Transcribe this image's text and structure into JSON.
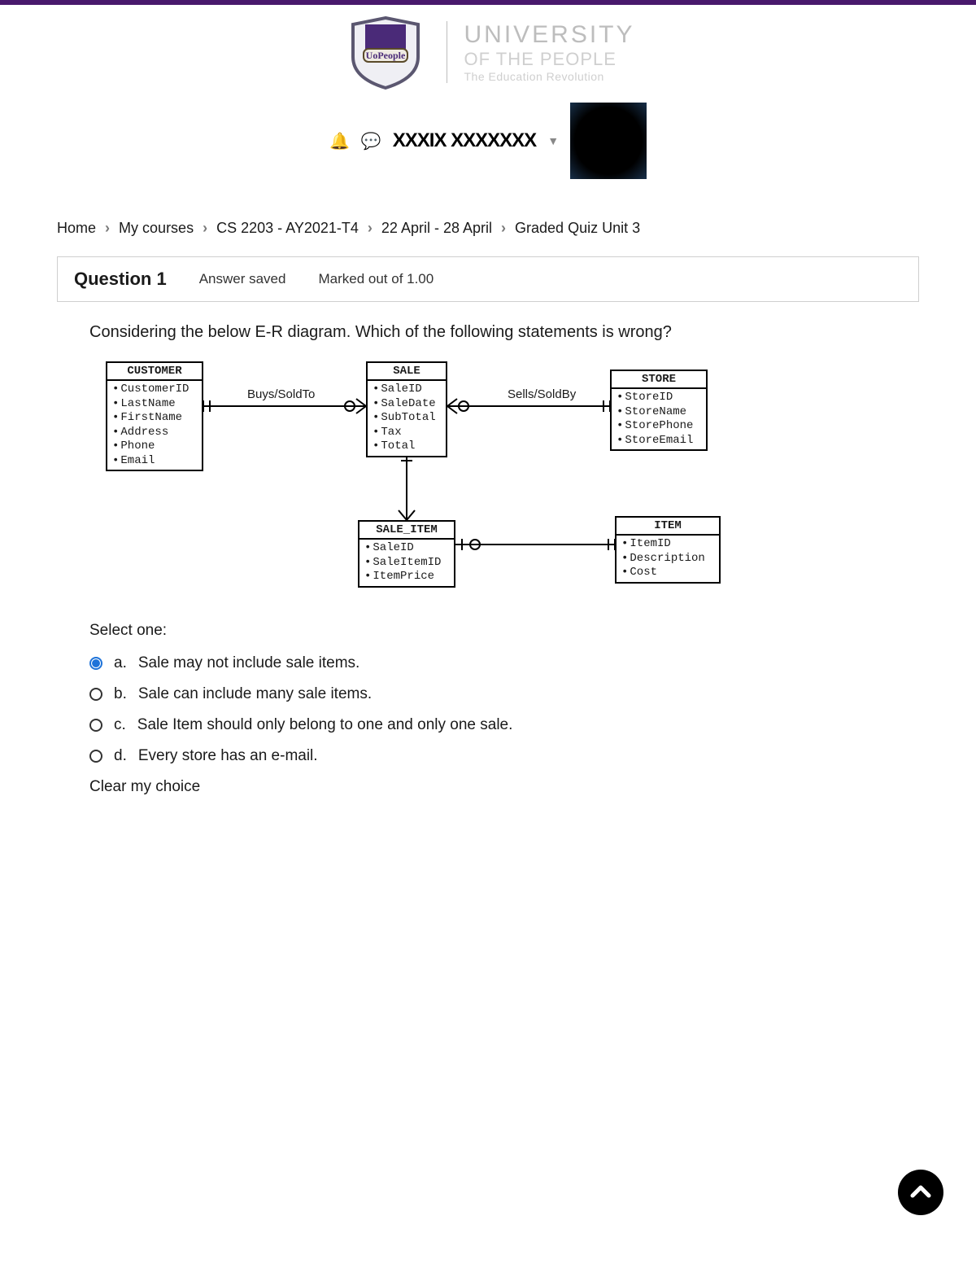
{
  "brand": {
    "line1": "UNIVERSITY",
    "line2": "OF THE PEOPLE",
    "line3": "The Education Revolution",
    "ribbon": "UoPeople"
  },
  "user": {
    "name_obscured": "XXXIX XXXXXXX"
  },
  "breadcrumb": {
    "items": [
      "Home",
      "My courses",
      "CS 2203 - AY2021-T4",
      "22 April - 28 April",
      "Graded Quiz Unit 3"
    ]
  },
  "question": {
    "label": "Question 1",
    "status": "Answer saved",
    "marks": "Marked out of 1.00",
    "prompt": "Considering the below E-R diagram. Which of the following statements is wrong?",
    "select_one": "Select one:",
    "options": [
      {
        "letter": "a.",
        "text": "Sale may not include sale items.",
        "selected": true
      },
      {
        "letter": "b.",
        "text": "Sale can include many sale items.",
        "selected": false
      },
      {
        "letter": "c.",
        "text": "Sale Item should only belong to one and only one sale.",
        "selected": false
      },
      {
        "letter": "d.",
        "text": "Every store has an e-mail.",
        "selected": false
      }
    ],
    "clear": "Clear my choice"
  },
  "diagram": {
    "entities": {
      "customer": {
        "title": "CUSTOMER",
        "attrs": [
          "CustomerID",
          "LastName",
          "FirstName",
          "Address",
          "Phone",
          "Email"
        ]
      },
      "sale": {
        "title": "SALE",
        "attrs": [
          "SaleID",
          "SaleDate",
          "SubTotal",
          "Tax",
          "Total"
        ]
      },
      "store": {
        "title": "STORE",
        "attrs": [
          "StoreID",
          "StoreName",
          "StorePhone",
          "StoreEmail"
        ]
      },
      "saleitem": {
        "title": "SALE_ITEM",
        "attrs": [
          "SaleID",
          "SaleItemID",
          "ItemPrice"
        ]
      },
      "item": {
        "title": "ITEM",
        "attrs": [
          "ItemID",
          "Description",
          "Cost"
        ]
      }
    },
    "relationships": {
      "cust_sale": "Buys/SoldTo",
      "sale_store": "Sells/SoldBy"
    }
  }
}
